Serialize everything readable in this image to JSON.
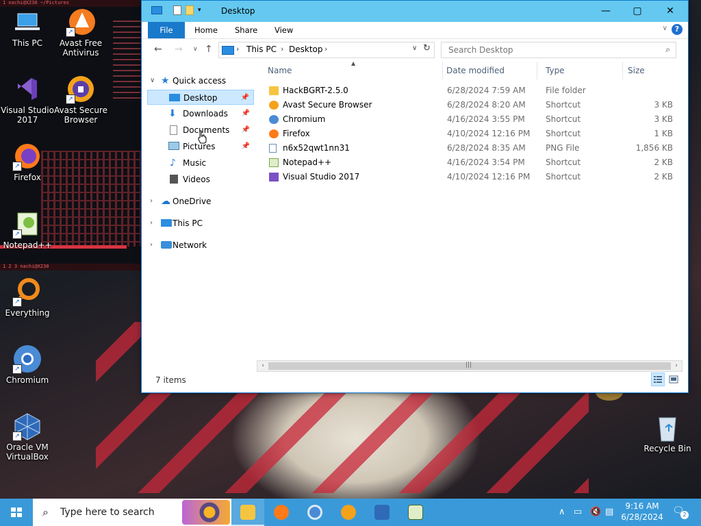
{
  "desktop": {
    "terminal_titles": [
      "1 nachi@X230 ~/Pictures",
      "1 2 3 nachi@X230"
    ],
    "icons": [
      {
        "label": "This PC",
        "icon": "this-pc-icon"
      },
      {
        "label": "Avast Free Antivirus",
        "icon": "avast-antivirus-icon"
      },
      {
        "label": "Visual Studio 2017",
        "icon": "visual-studio-icon"
      },
      {
        "label": "Avast Secure Browser",
        "icon": "avast-browser-icon"
      },
      {
        "label": "Firefox",
        "icon": "firefox-icon"
      },
      {
        "label": "Notepad++",
        "icon": "notepadpp-icon"
      },
      {
        "label": "Everything",
        "icon": "everything-icon"
      },
      {
        "label": "Chromium",
        "icon": "chromium-icon"
      },
      {
        "label": "Oracle VM VirtualBox",
        "icon": "virtualbox-icon"
      },
      {
        "label": "Recycle Bin",
        "icon": "recycle-bin-icon"
      }
    ]
  },
  "explorer": {
    "title": "Desktop",
    "ribbon_tabs": [
      "File",
      "Home",
      "Share",
      "View"
    ],
    "help_glyph": "?",
    "address": {
      "segments": [
        "This PC",
        "Desktop"
      ]
    },
    "search_placeholder": "Search Desktop",
    "nav": {
      "quick_access": "Quick access",
      "pinned": [
        "Desktop",
        "Downloads",
        "Documents",
        "Pictures"
      ],
      "unpinned": [
        "Music",
        "Videos"
      ],
      "roots": [
        "OneDrive",
        "This PC",
        "Network"
      ]
    },
    "columns": [
      "Name",
      "Date modified",
      "Type",
      "Size"
    ],
    "files": [
      {
        "name": "HackBGRT-2.5.0",
        "date": "6/28/2024 7:59 AM",
        "type": "File folder",
        "size": "",
        "icon": "folder-icon"
      },
      {
        "name": "Avast Secure Browser",
        "date": "6/28/2024 8:20 AM",
        "type": "Shortcut",
        "size": "3 KB",
        "icon": "avast-browser-icon"
      },
      {
        "name": "Chromium",
        "date": "4/16/2024 3:55 PM",
        "type": "Shortcut",
        "size": "3 KB",
        "icon": "chromium-icon"
      },
      {
        "name": "Firefox",
        "date": "4/10/2024 12:16 PM",
        "type": "Shortcut",
        "size": "1 KB",
        "icon": "firefox-icon"
      },
      {
        "name": "n6x52qwt1nn31",
        "date": "6/28/2024 8:35 AM",
        "type": "PNG File",
        "size": "1,856 KB",
        "icon": "png-file-icon"
      },
      {
        "name": "Notepad++",
        "date": "4/16/2024 3:54 PM",
        "type": "Shortcut",
        "size": "2 KB",
        "icon": "notepadpp-icon"
      },
      {
        "name": "Visual Studio 2017",
        "date": "4/10/2024 12:16 PM",
        "type": "Shortcut",
        "size": "2 KB",
        "icon": "visual-studio-icon"
      }
    ],
    "status": "7 items"
  },
  "taskbar": {
    "search_placeholder": "Type here to search",
    "time": "9:16 AM",
    "date": "6/28/2024",
    "notifications": "2",
    "apps": [
      "file-explorer-icon",
      "firefox-icon",
      "chromium-icon",
      "avast-browser-icon",
      "virtualbox-icon",
      "notepadpp-icon"
    ]
  },
  "colors": {
    "titlebar": "#64c8f0",
    "file_tab": "#1979ca",
    "taskbar": "#3a9ad9",
    "selection": "#cce8ff"
  }
}
